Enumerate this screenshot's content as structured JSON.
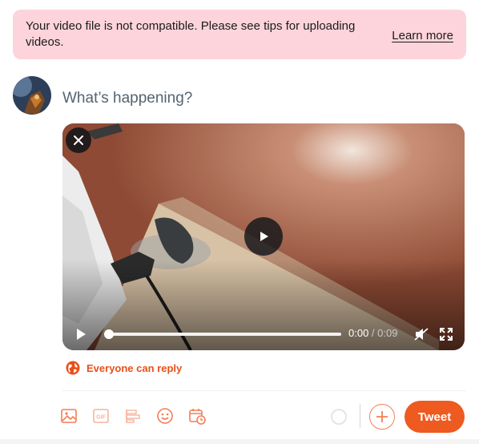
{
  "alert": {
    "message": "Your video file is not compatible. Please see tips for uploading videos.",
    "link_label": "Learn more",
    "background": "#fdd4dc"
  },
  "composer": {
    "avatar_icon": "user-avatar",
    "placeholder": "What’s happening?"
  },
  "media": {
    "remove_icon": "close-icon",
    "center_play_icon": "play-icon",
    "progress": 0.0,
    "current_time": "0:00",
    "separator": " / ",
    "duration": "0:09",
    "mute_icon": "muted-speaker-icon",
    "fullscreen_icon": "fullscreen-icon"
  },
  "reply_setting": {
    "icon": "globe-icon",
    "label": "Everyone can reply"
  },
  "toolbar": {
    "icons": [
      "image-icon",
      "gif-icon",
      "poll-icon",
      "emoji-icon",
      "schedule-icon"
    ],
    "add_icon": "plus-icon",
    "tweet_label": "Tweet"
  },
  "colors": {
    "accent": "#ee5a1f",
    "icon": "#f47e57",
    "placeholder": "#536471"
  }
}
